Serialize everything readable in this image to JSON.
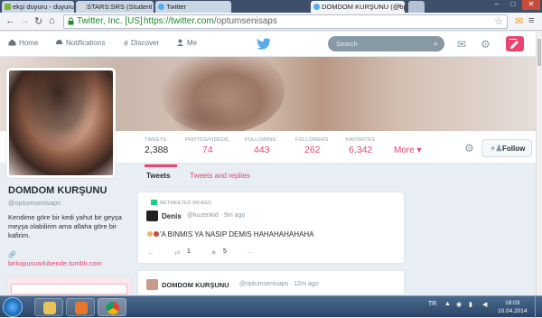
{
  "browser": {
    "tabs": [
      {
        "label": "ekşi duyuru - duyurulanmı"
      },
      {
        "label": "STARS:SRS (Student Revi"
      },
      {
        "label": "Twitter"
      },
      {
        "label": "DOMDOM KURŞUNU (@op"
      }
    ],
    "window_controls": [
      "–",
      "□",
      "✕"
    ],
    "address": {
      "ev_label": "Twitter, Inc. [US]",
      "scheme_host": "https://twitter.com",
      "path": "/optumsenisaps"
    }
  },
  "twitter_nav": {
    "home": "Home",
    "notifications": "Notifications",
    "discover": "Discover",
    "me": "Me",
    "search_placeholder": "Search",
    "icons": [
      "home-icon",
      "notifications-icon",
      "discover-icon",
      "me-icon",
      "twitter-bird-icon",
      "search-icon",
      "messages-icon",
      "settings-icon",
      "compose-tweet-icon"
    ],
    "accent": "#e8466e"
  },
  "profile": {
    "name": "DOMDOM KURŞUNU",
    "handle": "@optumsenisaps",
    "bio": "Kendime göre bir kedi yahut bir geyşa meyşa olabilirim ama allaha göre bir kafirim.",
    "link": "birkopusvarkibende.tumblr.com",
    "stats": [
      {
        "label": "TWEETS",
        "value": "2,388"
      },
      {
        "label": "PHOTOS/VIDEOS",
        "value": "74"
      },
      {
        "label": "FOLLOWING",
        "value": "443"
      },
      {
        "label": "FOLLOWERS",
        "value": "262"
      },
      {
        "label": "FAVORITES",
        "value": "6,342"
      }
    ],
    "more": "More ▾",
    "follow": "Follow"
  },
  "timeline": {
    "tabs": [
      "Tweets",
      "Tweets and replies"
    ],
    "tweets": [
      {
        "retweet_note": "RETWEETED 9M AGO",
        "author": "Denis",
        "handle": "@kuzenkid",
        "time": "· 9m ago",
        "text": "'A BINMIS YA NASIP DEMIS HAHAHAHAHAHA",
        "actions": [
          "←",
          "⇄",
          "1",
          "★",
          "5",
          "···"
        ]
      },
      {
        "author": "DOMDOM KURŞUNU",
        "handle": "@optumsenisaps · 12m ago"
      }
    ]
  },
  "taskbar": {
    "lang": "TR",
    "time": "18:03",
    "date": "10.04.2014"
  }
}
